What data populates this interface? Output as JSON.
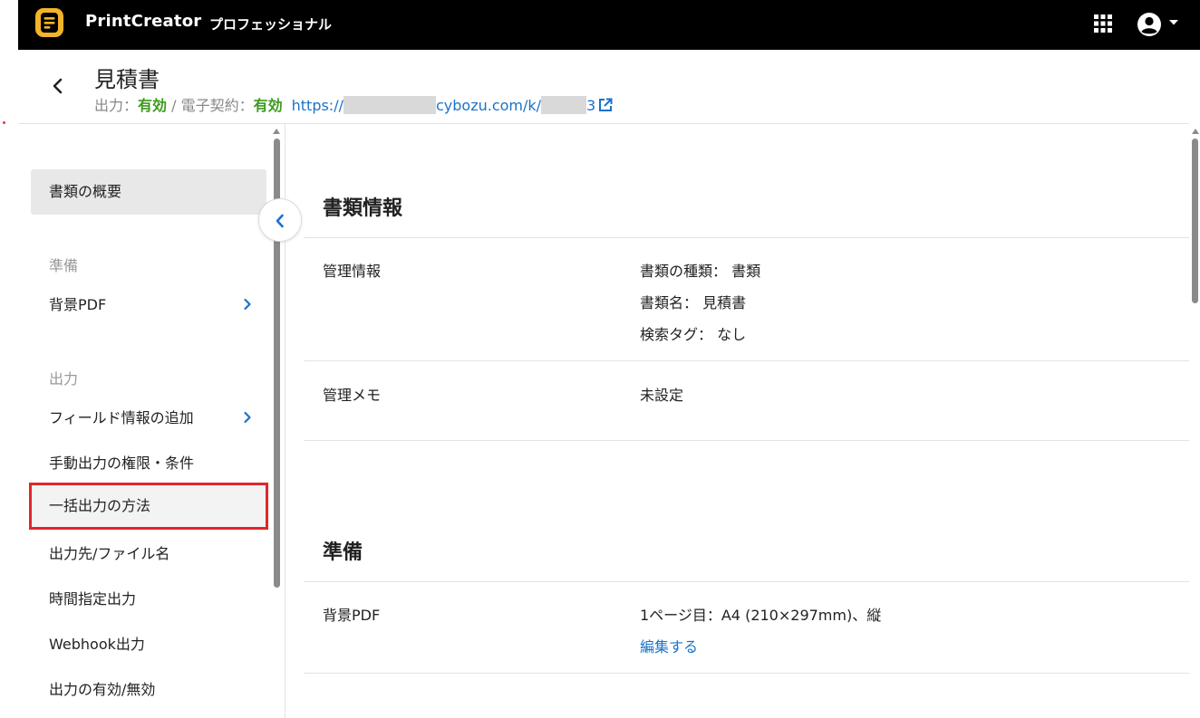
{
  "app": {
    "brand": "PrintCreator",
    "edition": "プロフェッショナル"
  },
  "header": {
    "title": "見積書",
    "output_label": "出力：",
    "output_status": "有効",
    "separator": " / ",
    "contract_label": "電子契約：",
    "contract_status": "有効",
    "url_prefix": "https://",
    "url_middle": "cybozu.com/k/",
    "url_suffix": "3"
  },
  "sidebar": {
    "overview": "書類の概要",
    "section_prepare": "準備",
    "background_pdf": "背景PDF",
    "section_output": "出力",
    "add_field_info": "フィールド情報の追加",
    "manual_output": "手動出力の権限・条件",
    "bulk_output": "一括出力の方法",
    "destination_filename": "出力先/ファイル名",
    "scheduled_output": "時間指定出力",
    "webhook_output": "Webhook出力",
    "output_toggle": "出力の有効/無効"
  },
  "main": {
    "doc_info": {
      "title": "書類情報",
      "mgmt_info_label": "管理情報",
      "doc_type": "書類の種類： 書類",
      "doc_name": "書類名： 見積書",
      "search_tags": "検索タグ： なし",
      "mgmt_memo_label": "管理メモ",
      "mgmt_memo_value": "未設定"
    },
    "prepare": {
      "title": "準備",
      "background_pdf_label": "背景PDF",
      "background_pdf_value": "1ページ目：A4 (210×297mm)、縦",
      "edit_link": "編集する"
    }
  },
  "colors": {
    "topbar": "#000000",
    "logo": "#f2b428",
    "status_on": "#3c9a1c",
    "link": "#1a73c8",
    "highlight_border": "#e0262a"
  }
}
